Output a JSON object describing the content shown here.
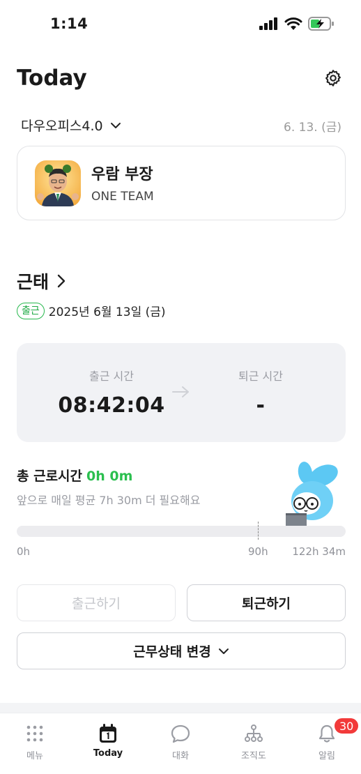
{
  "status_bar": {
    "time": "1:14"
  },
  "header": {
    "title": "Today"
  },
  "org": {
    "name": "다우오피스4.0",
    "date": "6. 13. (금)"
  },
  "profile": {
    "name": "우람 부장",
    "team": "ONE TEAM"
  },
  "attendance": {
    "title": "근태",
    "badge": "출근",
    "date": "2025년 6월 13일 (금)",
    "clock_in_label": "출근 시간",
    "clock_in_value": "08:42:04",
    "clock_out_label": "퇴근 시간",
    "clock_out_value": "-"
  },
  "work_total": {
    "label": "총 근로시간",
    "value": "0h 0m",
    "remain_text": "앞으로 매일 평균 7h 30m 더 필요해요",
    "progress_fraction": 0,
    "ticks": {
      "start": "0h",
      "target": "90h",
      "max": "122h 34m"
    }
  },
  "buttons": {
    "clock_in": "출근하기",
    "clock_out": "퇴근하기",
    "change_status": "근무상태 변경"
  },
  "tabs": [
    {
      "label": "메뉴",
      "icon": "grid-dots-icon"
    },
    {
      "label": "Today",
      "icon": "calendar-icon",
      "active": true
    },
    {
      "label": "대화",
      "icon": "chat-bubble-icon"
    },
    {
      "label": "조직도",
      "icon": "org-chart-icon"
    },
    {
      "label": "알림",
      "icon": "bell-icon",
      "badge": "30"
    }
  ],
  "colors": {
    "accent_green": "#2bbf4f",
    "badge_red": "#f23a3a"
  }
}
